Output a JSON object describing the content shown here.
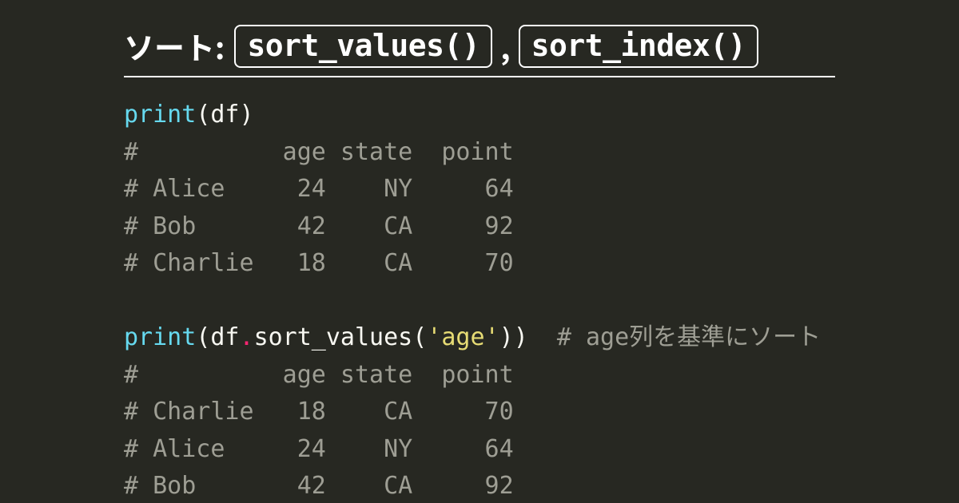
{
  "title": {
    "prefix": "ソート:",
    "pill1": "sort_values()",
    "separator": ",",
    "pill2": "sort_index()"
  },
  "code": {
    "line1": {
      "func": "print",
      "open": "(",
      "arg": "df",
      "close": ")"
    },
    "out1": {
      "h": "#          age state  point",
      "r1": "# Alice     24    NY     64",
      "r2": "# Bob       42    CA     92",
      "r3": "# Charlie   18    CA     70"
    },
    "line2": {
      "func": "print",
      "open": "(",
      "obj": "df",
      "dot": ".",
      "method": "sort_values",
      "open2": "(",
      "strq1": "'",
      "str": "age",
      "strq2": "'",
      "close2": ")",
      "close": ")",
      "trail_pad": "  ",
      "comment": "# age列を基準にソート"
    },
    "out2": {
      "h": "#          age state  point",
      "r1": "# Charlie   18    CA     70",
      "r2": "# Alice     24    NY     64",
      "r3": "# Bob       42    CA     92"
    }
  }
}
